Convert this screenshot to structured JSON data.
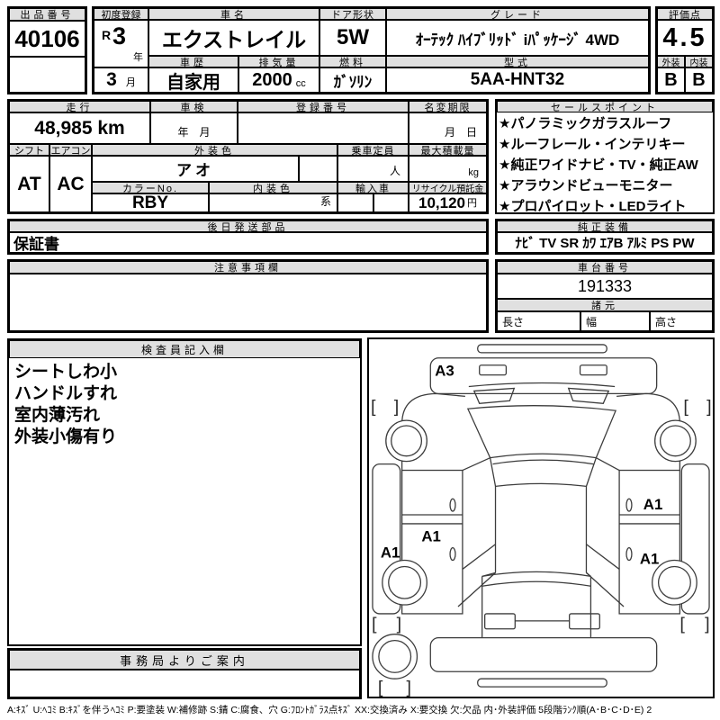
{
  "colors": {
    "header_bg": "#e0e0e0",
    "line": "#000000"
  },
  "top": {
    "auction_no_label": "出品番号",
    "auction_no": "40106",
    "first_reg_label": "初度登録",
    "first_reg_era": "R",
    "first_reg_year": "3",
    "year_suffix": "年",
    "first_reg_month": "3",
    "month_suffix": "月",
    "car_name_label": "車名",
    "car_name": "エクストレイル",
    "history_label": "車歴",
    "history": "自家用",
    "displacement_label": "排気量",
    "displacement": "2000",
    "displacement_unit": "cc",
    "door_label": "ドア形状",
    "door": "5W",
    "fuel_label": "燃料",
    "fuel": "ｶﾞｿﾘﾝ",
    "grade_label": "グレード",
    "grade": "ｵｰﾃｯｸ ﾊｲﾌﾞﾘｯﾄﾞ iﾊﾟｯｹｰｼﾞ 4WD",
    "model_label": "型式",
    "model": "5AA-HNT32",
    "score_label": "評価点",
    "score": "4.5",
    "exterior_label": "外装",
    "exterior_grade": "B",
    "interior_label": "内装",
    "interior_grade": "B"
  },
  "mid": {
    "mileage_label": "走行",
    "mileage": "48,985 km",
    "shaken_label": "車検",
    "shaken_value": "年　月",
    "reg_no_label": "登録番号",
    "reg_no": "",
    "name_change_label": "名変期限",
    "name_change_value": "月　日",
    "shift_label": "シフト",
    "shift": "AT",
    "aircon_label": "エアコン",
    "aircon": "AC",
    "ext_color_label": "外装色",
    "ext_color": "アオ",
    "color_no_label": "カラーNo.",
    "color_no": "RBY",
    "int_color_label": "内装色",
    "int_color_suffix": "系",
    "capacity_label": "乗車定員",
    "capacity_unit": "人",
    "max_load_label": "最大積載量",
    "max_load_unit": "kg",
    "import_label": "輸入車",
    "recycle_label": "リサイクル預託金",
    "recycle_value": "10,120",
    "recycle_unit": "円"
  },
  "sales": {
    "label": "セールスポイント",
    "items": [
      "★パノラミックガラスルーフ",
      "★ルーフレール・インテリキー",
      "★純正ワイドナビ・TV・純正AW",
      "★アラウンドビューモニター",
      "★プロパイロット・LEDライト"
    ]
  },
  "shipping": {
    "label": "後日発送部品",
    "value": "保証書"
  },
  "equipment": {
    "label": "純正装備",
    "value": "ﾅﾋﾞ TV SR ｶﾜ ｴｱB ｱﾙﾐ PS PW"
  },
  "notes": {
    "label": "注意事項欄",
    "value": ""
  },
  "chassis": {
    "label": "車台番号",
    "value": "191333"
  },
  "specs": {
    "label": "諸元",
    "length_label": "長さ",
    "width_label": "幅",
    "height_label": "高さ"
  },
  "inspector": {
    "label": "検査員記入欄",
    "lines": [
      "シートしわ小",
      "ハンドルすれ",
      "室内薄汚れ",
      "外装小傷有り"
    ]
  },
  "office": {
    "label": "事務局よりご案内",
    "value": ""
  },
  "diagram": {
    "mark_front_bumper": "A3",
    "mark_right_front_door": "A1",
    "mark_left_front_door": "A1",
    "mark_left_side": "A1",
    "mark_right_rear_door": "A1"
  },
  "legend": {
    "text": "A:ｷｽﾞ U:ﾍｺﾐ B:ｷｽﾞを伴うﾍｺﾐ P:要塗装 W:補修跡 S:錆 C:腐食、穴 G:ﾌﾛﾝﾄｶﾞﾗｽ点ｷｽﾞ XX:交換済み X:要交換 欠:欠品 内･外装評価 5段階ﾗﾝｸ順(A･B･C･D･E) 2"
  }
}
